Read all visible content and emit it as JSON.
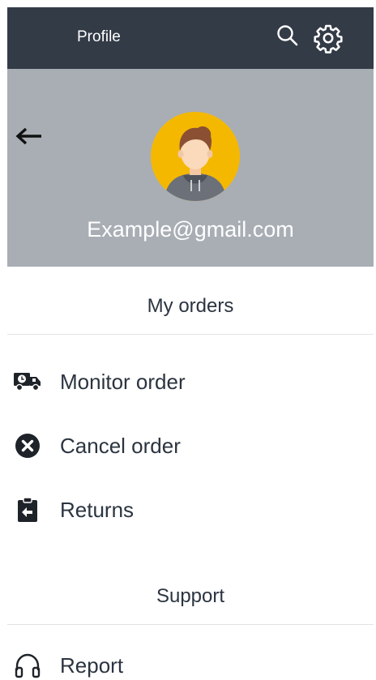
{
  "topbar": {
    "title": "Profile",
    "search_icon": "search-icon",
    "settings_icon": "gear-icon",
    "background": "#333b47"
  },
  "profile": {
    "email": "Example@gmail.com",
    "back_icon": "arrow-left-icon",
    "header_background": "#a9aeb5",
    "avatar_color": "#f5b800"
  },
  "orders_section": {
    "title": "My orders",
    "items": [
      {
        "label": "Monitor order",
        "icon": "delivery-truck-icon"
      },
      {
        "label": "Cancel order",
        "icon": "cancel-circle-icon"
      },
      {
        "label": "Returns",
        "icon": "clipboard-return-icon"
      }
    ]
  },
  "support_section": {
    "title": "Support",
    "items": [
      {
        "label": "Report",
        "icon": "headphones-icon"
      }
    ]
  }
}
